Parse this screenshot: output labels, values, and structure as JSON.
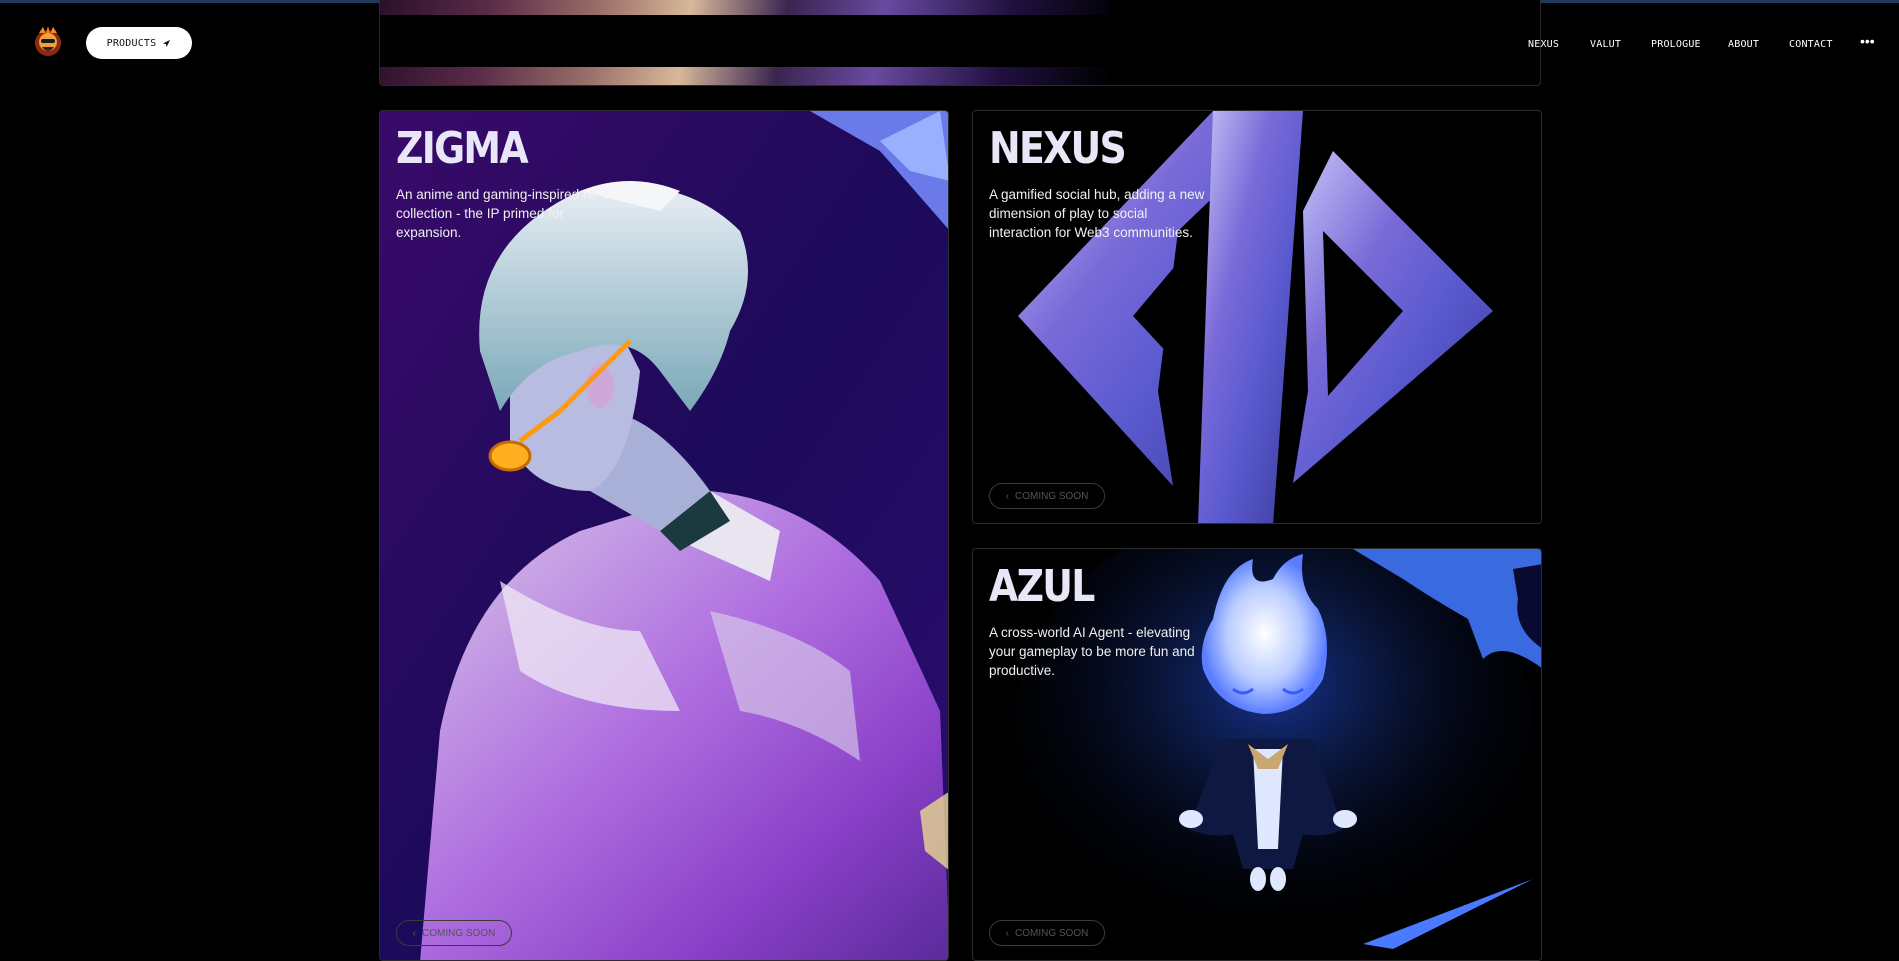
{
  "header": {
    "products_label": "PRODUCTS",
    "nav": [
      "NEXUS",
      "VALUT",
      "PROLOGUE",
      "ABOUT",
      "CONTACT"
    ],
    "more_label": "•••"
  },
  "cards": [
    {
      "title": "ZIGMA",
      "description": "An anime and gaming-inspired NFT collection - the IP primed for expansion.",
      "button": "COMING SOON"
    },
    {
      "title": "NEXUS",
      "description": "A gamified social hub, adding a new dimension of play to social interaction for Web3 communities.",
      "button": "COMING SOON"
    },
    {
      "title": "AZUL",
      "description": "A cross-world AI Agent - elevating your gameplay to be more fun and productive.",
      "button": "COMING SOON"
    }
  ],
  "colors": {
    "background": "#000000",
    "accent_purple": "#6a4ad0",
    "azul_glow": "#5a8cff"
  }
}
